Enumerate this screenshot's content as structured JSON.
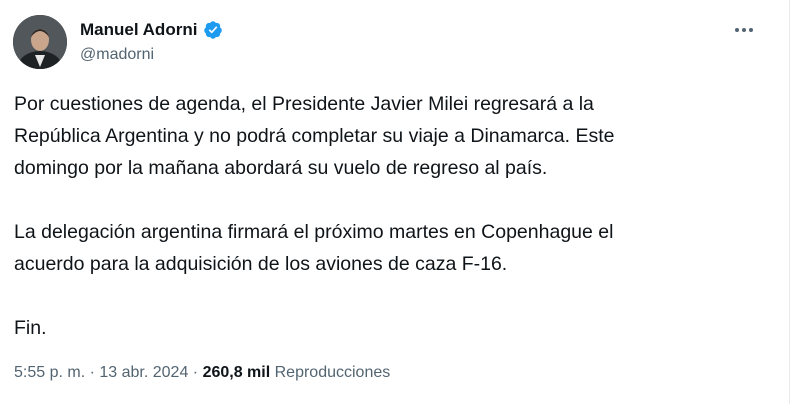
{
  "author": {
    "name": "Manuel Adorni",
    "handle": "@madorni"
  },
  "icons": {
    "verified": "verified-badge-icon",
    "more": "more-options-icon"
  },
  "colors": {
    "verified": "#1d9bf0",
    "text": "#0f1419",
    "secondary": "#536471"
  },
  "tweet": {
    "line1": "Por cuestiones de agenda, el Presidente Javier Milei regresará a la",
    "line2": "República Argentina y no podrá completar su viaje a Dinamarca. Este",
    "line3": "domingo por la mañana abordará su vuelo de regreso al país.",
    "line4": "La delegación argentina firmará el próximo martes en Copenhague el",
    "line5": "acuerdo para la adquisición de los aviones de caza F-16.",
    "line6": "Fin."
  },
  "meta": {
    "time": "5:55 p. m.",
    "separator1": " · ",
    "date": "13 abr. 2024",
    "separator2": " · ",
    "views_count": "260,8 mil",
    "views_label": " Reproducciones"
  }
}
